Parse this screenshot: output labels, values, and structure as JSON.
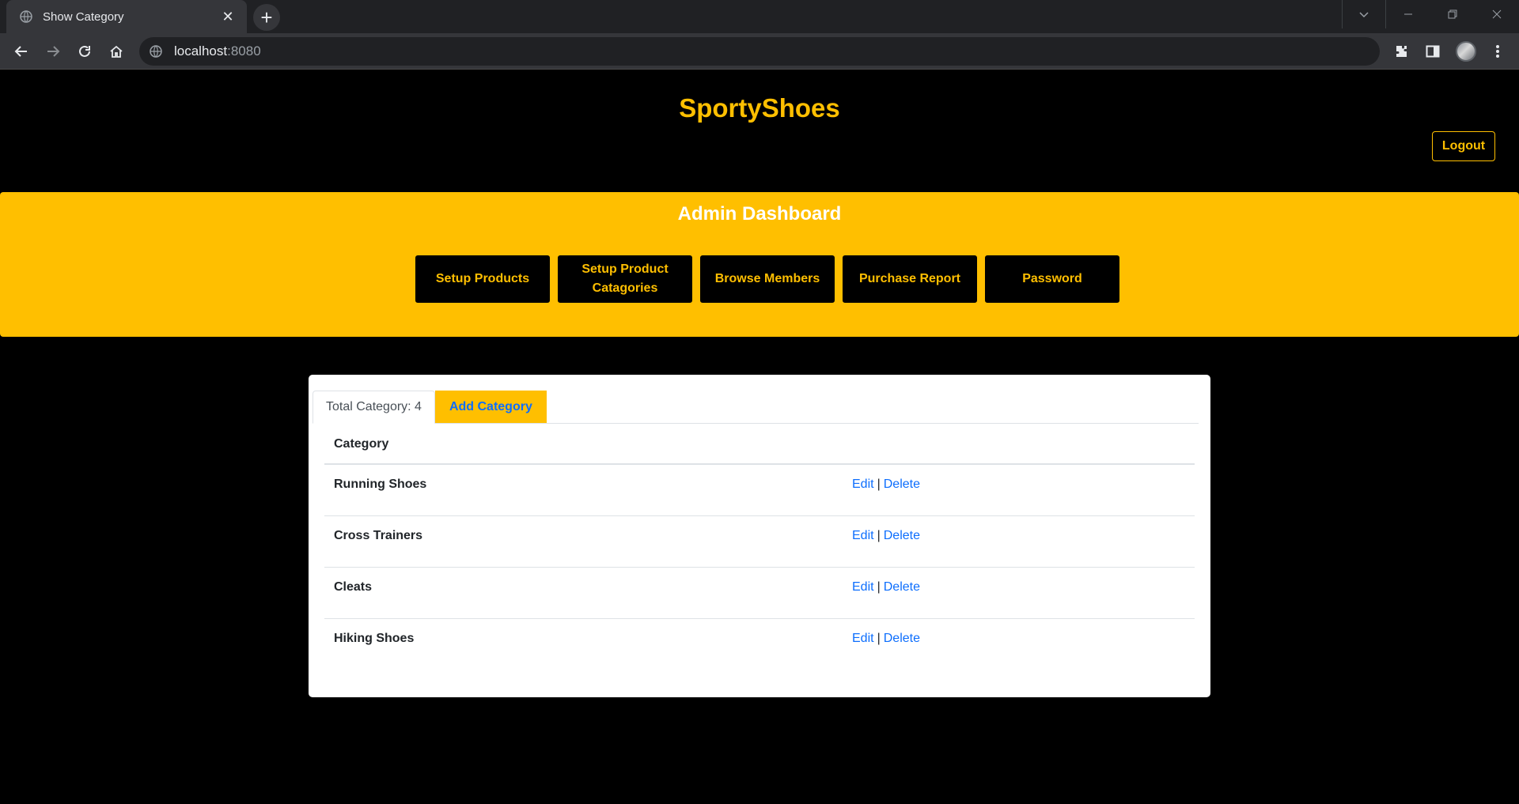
{
  "browser": {
    "tab_title": "Show Category",
    "tab_close": "✕",
    "new_tab": "+",
    "url_host": "localhost",
    "url_port": ":8080"
  },
  "header": {
    "brand": "SportyShoes",
    "logout_label": "Logout"
  },
  "dashboard": {
    "title": "Admin Dashboard",
    "buttons": [
      {
        "label": "Setup Products"
      },
      {
        "label": "Setup Product Catagories"
      },
      {
        "label": "Browse Members"
      },
      {
        "label": "Purchase Report"
      },
      {
        "label": "Password"
      }
    ]
  },
  "categories": {
    "total_label": "Total Category: 4",
    "add_label": "Add Category",
    "column_header": "Category",
    "rows": [
      {
        "name": "Running Shoes",
        "edit": "Edit",
        "sep": "|",
        "delete": "Delete"
      },
      {
        "name": "Cross Trainers",
        "edit": "Edit",
        "sep": "|",
        "delete": "Delete"
      },
      {
        "name": "Cleats",
        "edit": "Edit",
        "sep": "|",
        "delete": "Delete"
      },
      {
        "name": "Hiking Shoes",
        "edit": "Edit",
        "sep": "|",
        "delete": "Delete"
      }
    ]
  },
  "colors": {
    "accent": "#ffbf00",
    "link": "#0d6efd",
    "background": "#000000"
  }
}
